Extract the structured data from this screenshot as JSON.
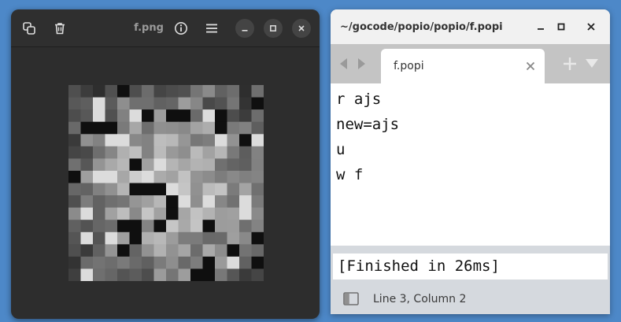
{
  "viewer": {
    "title": "f.png",
    "icons": [
      "copy-icon",
      "trash-icon",
      "info-icon",
      "menu-icon",
      "minimize-icon",
      "maximize-icon",
      "close-icon"
    ]
  },
  "editor": {
    "window_title": "~/gocode/popio/popio/f.popi",
    "tab_label": "f.popi",
    "code_lines": [
      "r ajs",
      "new=ajs",
      "u",
      "w f"
    ],
    "output": "[Finished in 26ms]",
    "status": "Line 3, Column 2"
  },
  "colors": {
    "desktop": "#4d88c8",
    "viewer_bg": "#2d2d2d",
    "editor_tabbar": "#c4c4c4",
    "editor_status": "#d5d9de"
  }
}
